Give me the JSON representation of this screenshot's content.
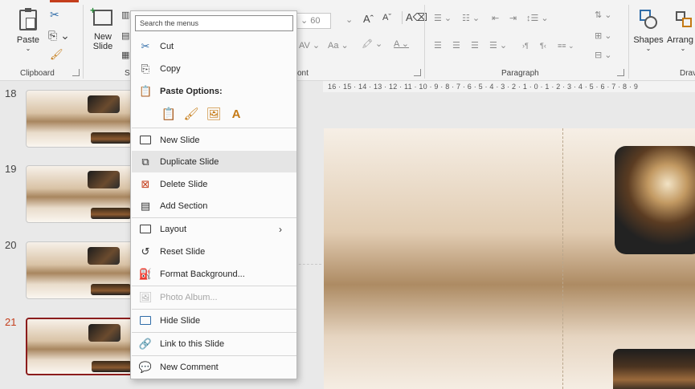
{
  "ribbon": {
    "paste_label": "Paste",
    "new_slide_label": "New\nSlide",
    "shapes_label": "Shapes",
    "arrange_label": "Arrang",
    "font_size_value": "60",
    "groups": {
      "clipboard": "Clipboard",
      "slides_partial": "S",
      "font_partial": "ont",
      "paragraph": "Paragraph",
      "drawing_partial": "Drav"
    }
  },
  "ruler": {
    "text": "16 · 15 · 14 · 13 · 12 · 11 · 10 · 9 · 8 · 7 · 6 · 5 · 4 · 3 · 2 · 1 · 0 · 1 · 2 · 3 · 4 · 5 · 6 · 7 · 8 · 9"
  },
  "thumbnails": [
    {
      "number": "18",
      "active": false
    },
    {
      "number": "19",
      "active": false
    },
    {
      "number": "20",
      "active": false
    },
    {
      "number": "21",
      "active": true
    }
  ],
  "context_menu": {
    "search_placeholder": "Search the menus",
    "paste_options_label": "Paste Options:",
    "items": {
      "cut": "Cut",
      "copy": "Copy",
      "new_slide": "New Slide",
      "duplicate_slide": "Duplicate Slide",
      "delete_slide": "Delete Slide",
      "add_section": "Add Section",
      "layout": "Layout",
      "reset_slide": "Reset Slide",
      "format_background": "Format Background...",
      "photo_album": "Photo Album...",
      "hide_slide": "Hide Slide",
      "link_to_slide": "Link to this Slide",
      "new_comment": "New Comment"
    },
    "icons": {
      "cut": "scissors-icon",
      "copy": "copy-icon",
      "paste_options": "clipboard-icon",
      "new_slide": "new-slide-icon",
      "duplicate_slide": "duplicate-slide-icon",
      "delete_slide": "delete-slide-icon",
      "add_section": "section-icon",
      "layout": "layout-icon",
      "reset_slide": "reset-icon",
      "format_background": "paint-bucket-icon",
      "photo_album": "photo-album-icon",
      "hide_slide": "hide-slide-icon",
      "link_to_slide": "link-icon",
      "new_comment": "comment-icon"
    }
  },
  "colors": {
    "accent": "#c43e1c",
    "active_slide_border": "#8b1c1c",
    "menu_hover": "#e5e5e5",
    "paste_icon": "#c57a15"
  }
}
